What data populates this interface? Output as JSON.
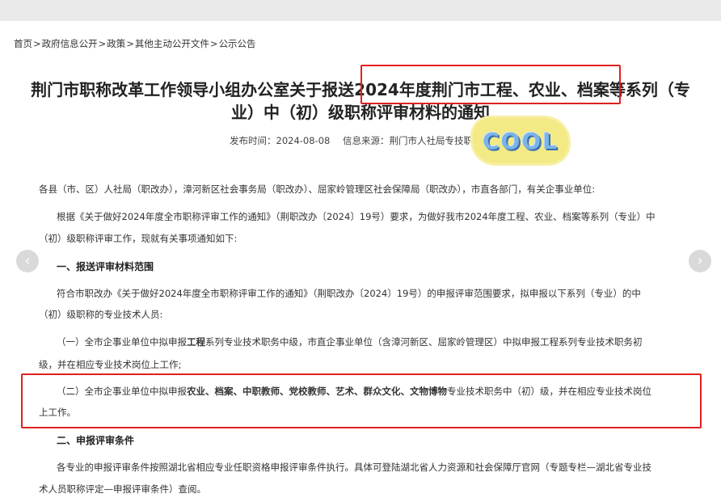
{
  "breadcrumb": {
    "items": [
      "首页",
      "政府信息公开",
      "政策",
      "其他主动公开文件",
      "公示公告"
    ],
    "separator": ">"
  },
  "article": {
    "title_line1": "荆门市职称改革工作领导小组办公室关于报送2024年度荆门市工程、农业、档案等系列（专",
    "title_line2": "业）中（初）级职称评审材料的通知",
    "publish_label": "发布时间：2024-08-08",
    "source_label": "信息来源：荆门市人社局专技职称科",
    "salutation": "各县（市、区）人社局（职改办），漳河新区社会事务局（职改办）、屈家岭管理区社会保障局（职改办），市直各部门，有关企事业单位:",
    "p1_line1": "根据《关于做好2024年度全市职称评审工作的通知》（荆职改办〔2024〕19号）要求，为做好我市2024年度工程、农业、档案等系列（专业）中",
    "p1_line2": "（初）级职称评审工作，现就有关事项通知如下:",
    "h1": "一、报送评审材料范围",
    "p2_line1": "符合市职改办《关于做好2024年度全市职称评审工作的通知》（荆职改办〔2024〕19号）的申报评审范围要求，拟申报以下系列（专业）的中",
    "p2_line2": "（初）级职称的专业技术人员:",
    "item1_pre": "（一）全市企事业单位中拟申报",
    "item1_bold": "工程",
    "item1_post": "系列专业技术职务中级，市直企事业单位（含漳河新区、屈家岭管理区）中拟申报工程系列专业技术职务初",
    "item1_line2": "级，并在相应专业技术岗位上工作;",
    "item2_pre": "（二）全市企事业单位中拟申报",
    "item2_bold": "农业、档案、中职教师、党校教师、艺术、群众文化、文物博物",
    "item2_post": "专业技术职务中（初）级，并在相应专业技术岗位",
    "item2_line2": "上工作。",
    "h2": "二、申报评审条件",
    "p3_line1": "各专业的申报评审条件按照湖北省相应专业任职资格申报评审条件执行。具体可登陆湖北省人力资源和社会保障厅官网（专题专栏—湖北省专业技",
    "p3_line2": "术人员职称评定—申报评审条件）查阅。"
  },
  "sticker": {
    "text": "COOL"
  },
  "nav": {
    "prev_icon": "chevron-left-icon",
    "next_icon": "chevron-right-icon"
  },
  "colors": {
    "highlight": "#e02020",
    "sticker_bg": "#f3ea86",
    "sticker_text": "#7cb4e8"
  }
}
